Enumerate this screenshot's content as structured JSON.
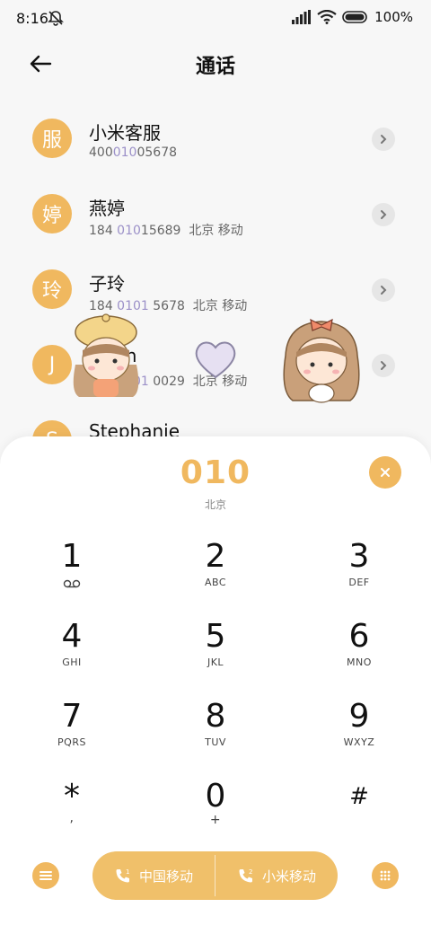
{
  "status_bar": {
    "time": "8:16",
    "battery_text": "100%"
  },
  "header": {
    "title": "通话"
  },
  "contacts": [
    {
      "avatar": "服",
      "name": "小米客服",
      "num_pre": "400",
      "num_hl": "010",
      "num_post": "05678",
      "location": ""
    },
    {
      "avatar": "婷",
      "name": "燕婷",
      "num_pre": "184 ",
      "num_hl": "010",
      "num_post": "15689",
      "location": "  北京 移动"
    },
    {
      "avatar": "玲",
      "name": "子玲",
      "num_pre": "184 ",
      "num_hl": "0101",
      "num_post": " 5678",
      "location": "  北京 移动"
    },
    {
      "avatar": "J",
      "name": "Jason",
      "num_pre": "184 ",
      "num_hl": "0101",
      "num_post": " 0029",
      "location": "  北京 移动"
    },
    {
      "avatar": "S",
      "name": "Stephanie",
      "num_pre": "",
      "num_hl": "",
      "num_post": "",
      "location": ""
    }
  ],
  "dialer": {
    "dialed_number": "010",
    "region": "北京",
    "keys": [
      {
        "digit": "1",
        "letters": ""
      },
      {
        "digit": "2",
        "letters": "ABC"
      },
      {
        "digit": "3",
        "letters": "DEF"
      },
      {
        "digit": "4",
        "letters": "GHI"
      },
      {
        "digit": "5",
        "letters": "JKL"
      },
      {
        "digit": "6",
        "letters": "MNO"
      },
      {
        "digit": "7",
        "letters": "PQRS"
      },
      {
        "digit": "8",
        "letters": "TUV"
      },
      {
        "digit": "9",
        "letters": "WXYZ"
      },
      {
        "digit": "*",
        "letters": ","
      },
      {
        "digit": "0",
        "letters": "+"
      },
      {
        "digit": "#",
        "letters": ""
      }
    ],
    "call_sim1": "中国移动",
    "call_sim2": "小米移动"
  },
  "colors": {
    "accent": "#f0b85f",
    "highlight": "#9b90c8",
    "panel": "#ffffff",
    "background": "#f7f7f7"
  },
  "icons": [
    "muted-bell-icon",
    "signal-icon",
    "wifi-icon",
    "battery-icon",
    "back-arrow-icon",
    "chevron-right-icon",
    "clear-icon",
    "voicemail-icon",
    "menu-icon",
    "dialpad-icon",
    "phone-sim1-icon",
    "phone-sim2-icon"
  ]
}
